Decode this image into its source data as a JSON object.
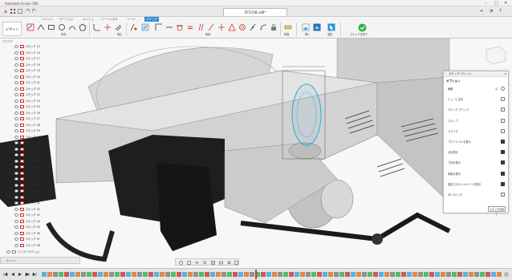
{
  "window": {
    "title": "Autodesk Fusion 360"
  },
  "document": {
    "tab_title": "DT115B v46*"
  },
  "ribbon": {
    "design_button": "デザイン",
    "tabs": [
      {
        "label": "ソリッド",
        "active": false
      },
      {
        "label": "サーフェス",
        "active": false
      },
      {
        "label": "メッシュ",
        "active": false
      },
      {
        "label": "シートメタル",
        "active": false
      },
      {
        "label": "ツール",
        "active": false
      },
      {
        "label": "スケッチ",
        "active": true
      }
    ],
    "groups": {
      "create": "作成",
      "modify": "修正",
      "constraints": "拘束",
      "inspect": "検査",
      "insert": "挿入",
      "select": "選択",
      "finish": "スケッチを終了"
    }
  },
  "browser": {
    "header": "ブラウザ",
    "items": [
      "スケッチ 15",
      "スケッチ 16",
      "スケッチ 17",
      "スケッチ 18",
      "スケッチ 19",
      "スケッチ 20",
      "スケッチ 21",
      "スケッチ 22",
      "スケッチ 23",
      "スケッチ 24",
      "スケッチ 25",
      "スケッチ 26",
      "スケッチ 27",
      "スケッチ 28",
      "スケッチ 29",
      "スケッチ 30",
      "スケッチ 31",
      "スケッチ 32",
      "スケッチ 33",
      "スケッチ 34",
      "スケッチ 35",
      "スケッチ 36",
      "スケッチ 37",
      "スケッチ 38",
      "スケッチ 39",
      "スケッチ 40",
      "スケッチ 41",
      "スケッチ 42",
      "スケッチ 43",
      "スケッチ 44",
      "スケッチ 45",
      "スケッチ 46",
      "スケッチ 47",
      "スケッチ 48"
    ],
    "construction": "コンストラクション"
  },
  "sketch_palette": {
    "title": "スケッチ パレット",
    "section": "オプション",
    "rows": [
      {
        "label": "線種",
        "control": "icons"
      },
      {
        "label": "ビューに正対",
        "control": "button"
      },
      {
        "label": "スケッチ グリッド",
        "control": "check",
        "checked": false
      },
      {
        "label": "スナップ",
        "control": "check",
        "checked": false
      },
      {
        "label": "スライス",
        "control": "check",
        "checked": false
      },
      {
        "label": "プロファイルを表示",
        "control": "check",
        "checked": true
      },
      {
        "label": "点を表示",
        "control": "check",
        "checked": true
      },
      {
        "label": "寸法を表示",
        "control": "check",
        "checked": true
      },
      {
        "label": "拘束を表示",
        "control": "check",
        "checked": true
      },
      {
        "label": "投影されたジオメトリを表示",
        "control": "check",
        "checked": true
      },
      {
        "label": "3D スケッチ",
        "control": "check",
        "checked": false
      }
    ],
    "finish_button": "スケッチを終了"
  },
  "comments": {
    "label": "コメント"
  },
  "icons": {
    "app": "fusion-logo-icon",
    "grid": "apps-grid-icon",
    "save": "save-icon",
    "undo": "undo-icon",
    "redo": "redo-icon",
    "viewcube": "viewcube-icon",
    "finish": "check-circle-icon"
  },
  "colors": {
    "accent": "#2b8fd6",
    "finish_green": "#2fb24a",
    "sketch_blue": "#2ea8df",
    "model_gray": "#cfcfcf",
    "model_dark": "#1e1e1e"
  }
}
